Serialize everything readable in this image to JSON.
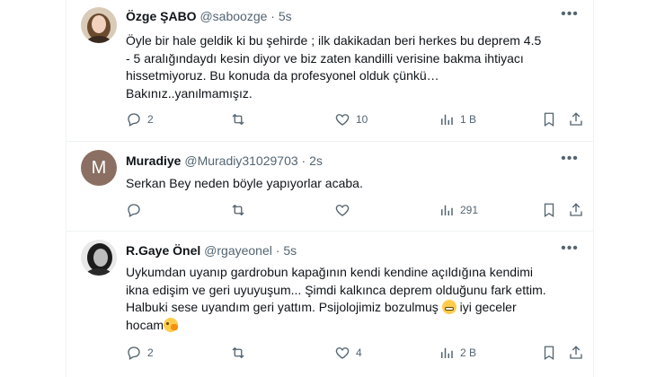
{
  "tweets": [
    {
      "name": "Özge ŞABO",
      "handle": "@saboozge",
      "sep": "·",
      "time": "5s",
      "more_label": "•••",
      "text": [
        "Öyle bir hale geldik ki bu şehirde ; ilk dakikadan beri herkes bu deprem 4.5",
        "- 5 aralığındaydı kesin diyor ve biz zaten kandilli verisine bakma ihtiyacı",
        "hissetmiyoruz. Bu konuda da profesyonel olduk çünkü…",
        "Bakınız..yanılmamışız."
      ],
      "replies": "2",
      "retweets": "",
      "likes": "10",
      "views": "1 B"
    },
    {
      "name": "Muradiye",
      "handle": "@Muradiy31029703",
      "sep": "·",
      "time": "2s",
      "more_label": "•••",
      "avatar_letter": "M",
      "avatar_color": "#8b6f63",
      "text": [
        "Serkan Bey neden böyle yapıyorlar acaba."
      ],
      "replies": "",
      "retweets": "",
      "likes": "",
      "views": "291"
    },
    {
      "name": "R.Gaye Önel",
      "handle": "@rgayeonel",
      "sep": "·",
      "time": "5s",
      "more_label": "•••",
      "text": [
        "Uykumdan uyanıp gardrobun kapağının kendi kendine açıldığına kendimi",
        "ikna edişim ve geri uyuyuşum... Şimdi kalkınca deprem olduğunu fark ettim.",
        "Halbuki sese uyandım geri yattım. Psijolojimiz bozulmuş",
        "iyi geceler",
        "hocam"
      ],
      "replies": "2",
      "retweets": "",
      "likes": "4",
      "views": "2 B"
    }
  ],
  "icons": {
    "reply": "reply-icon",
    "retweet": "retweet-icon",
    "like": "like-icon",
    "views": "views-icon",
    "bookmark": "bookmark-icon",
    "share": "share-icon",
    "emoji_grimace": "grimacing-face-emoji",
    "emoji_peek": "face-peeking-emoji"
  },
  "colors": {
    "text": "#0f1419",
    "meta": "#536471",
    "border": "#eff3f4"
  }
}
